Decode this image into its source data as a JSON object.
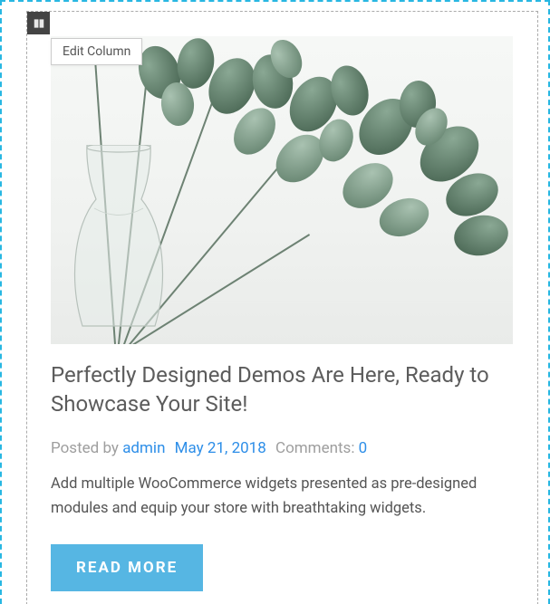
{
  "editor": {
    "handle_title": "Column",
    "tooltip": "Edit Column"
  },
  "post": {
    "title": "Perfectly Designed Demos Are Here, Ready to Showcase Your Site!",
    "meta": {
      "posted_by_label": "Posted by",
      "author": "admin",
      "date": "May 21, 2018",
      "comments_label": "Comments:",
      "comments_count": "0"
    },
    "excerpt": "Add multiple WooCommerce widgets presented as pre-designed modules and equip your store with breathtaking widgets.",
    "button": "READ MORE"
  },
  "image": {
    "alt": "Eucalyptus branches in a clear glass vase"
  },
  "colors": {
    "accent": "#56b6e3",
    "link": "#2d8ee8",
    "editor_border": "#28b7e2"
  }
}
